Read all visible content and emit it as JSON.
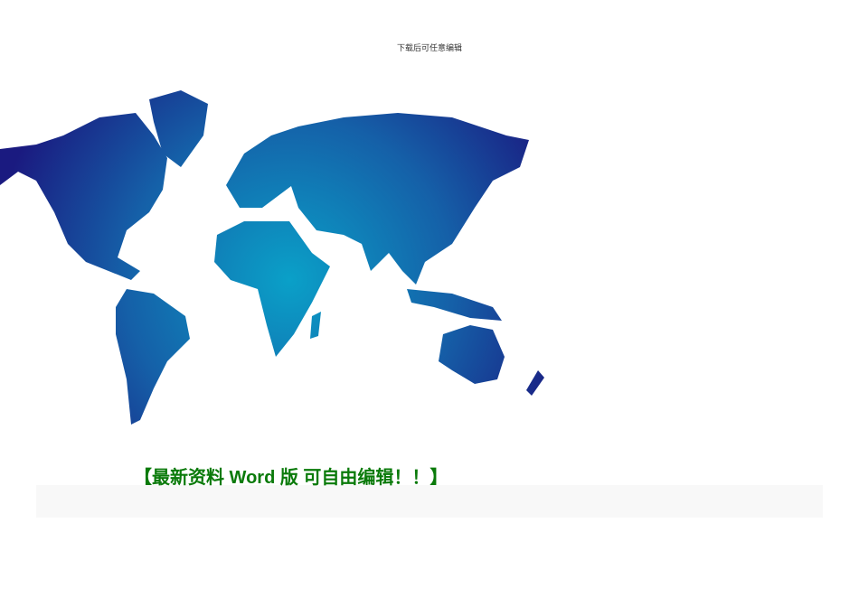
{
  "header": {
    "text": "下载后可任意编辑"
  },
  "map": {
    "icon": "world-map",
    "colors": {
      "dark": "#1a1a80",
      "light": "#0aa0c8"
    }
  },
  "banner": {
    "text": "【最新资料  Word 版  可自由编辑！！】",
    "color": "#0a7a0a"
  }
}
